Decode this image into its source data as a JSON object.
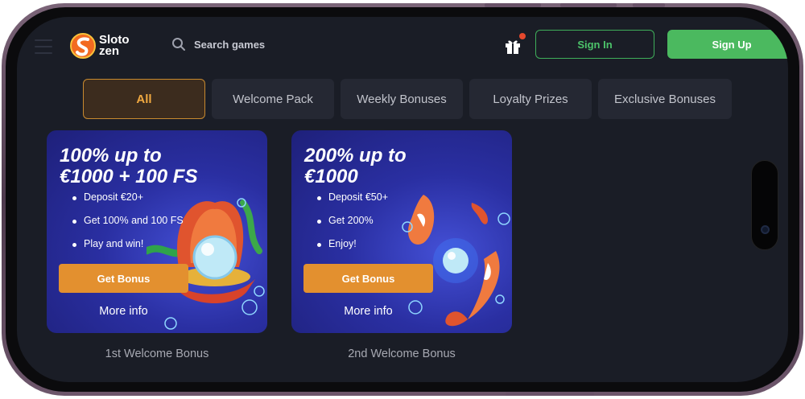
{
  "header": {
    "logo_line1": "Sloto",
    "logo_line2": "zen",
    "search_placeholder": "Search games",
    "sign_in_label": "Sign In",
    "sign_up_label": "Sign Up"
  },
  "tabs": [
    {
      "label": "All",
      "active": true
    },
    {
      "label": "Welcome Pack",
      "active": false
    },
    {
      "label": "Weekly Bonuses",
      "active": false
    },
    {
      "label": "Loyalty Prizes",
      "active": false
    },
    {
      "label": "Exclusive Bonuses",
      "active": false
    }
  ],
  "cards": [
    {
      "title_line1": "100% up to",
      "title_line2": "€1000 + 100 FS",
      "bullets": [
        "Deposit €20+",
        "Get 100% and 100 FS",
        "Play and win!"
      ],
      "cta": "Get Bonus",
      "more": "More info",
      "caption": "1st Welcome Bonus",
      "art": "pearl-shell-icon"
    },
    {
      "title_line1": "200% up to",
      "title_line2": "€1000",
      "bullets": [
        "Deposit €50+",
        "Get 200%",
        "Enjoy!"
      ],
      "cta": "Get Bonus",
      "more": "More info",
      "caption": "2nd Welcome Bonus",
      "art": "koi-fish-icon"
    }
  ],
  "colors": {
    "accent_green": "#4bb95f",
    "accent_orange": "#e3902f",
    "background": "#1a1d26",
    "card_blue": "#2a2fa2"
  }
}
